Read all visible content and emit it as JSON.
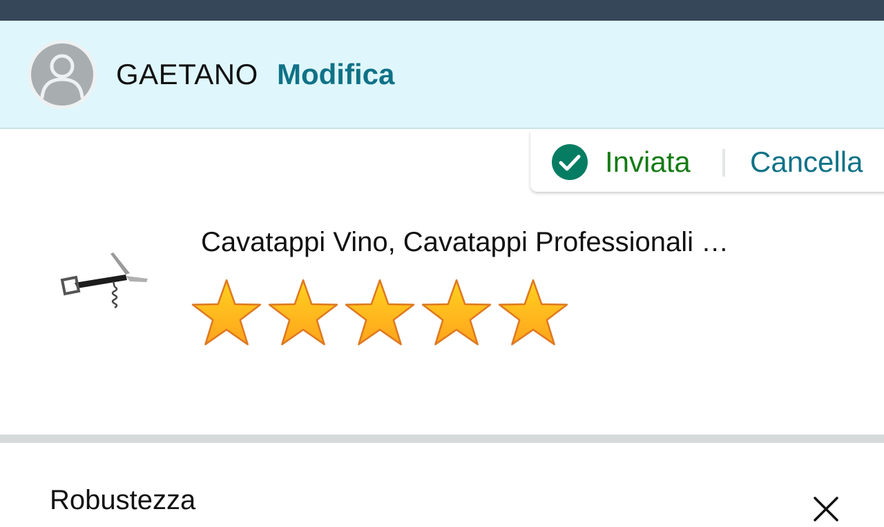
{
  "colors": {
    "status_bar": "#37475a",
    "header_bg": "#dff7fc",
    "link": "#0f7287",
    "success": "#137b13",
    "success_icon": "#067d62",
    "star_fill": "#ffa41c",
    "star_stroke": "#de7921",
    "separator": "#d5d9d9"
  },
  "profile": {
    "avatar_icon": "user-avatar-icon",
    "name": "GAETANO",
    "edit_label": "Modifica"
  },
  "review_status": {
    "icon": "check-circle-icon",
    "sent_label": "Inviata",
    "cancel_label": "Cancella"
  },
  "product": {
    "image_icon": "corkscrew-image",
    "title": "Cavatappi Vino, Cavatappi Professionali …",
    "rating": 5,
    "rating_max": 5
  },
  "attribute": {
    "label": "Robustezza",
    "close_icon": "close-icon"
  }
}
